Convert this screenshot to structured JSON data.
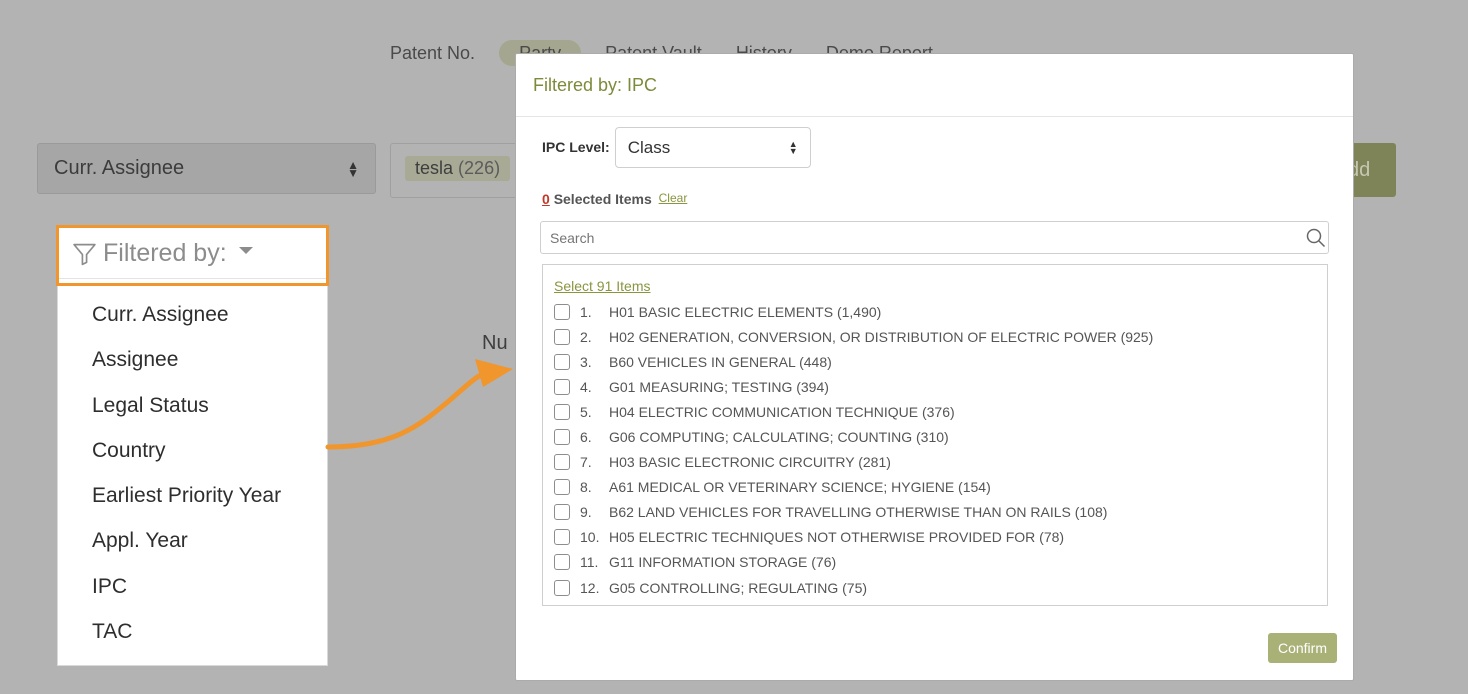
{
  "nav": {
    "tabs": [
      "Patent No.",
      "Party",
      "Patent Vault",
      "History",
      "Demo Report"
    ]
  },
  "search_bar": {
    "field": "Curr. Assignee",
    "tag": "tesla",
    "tag_count": "(226)",
    "add": "dd"
  },
  "background_text": "Nu",
  "filter_panel": {
    "label": "Filtered by:",
    "options": [
      "Curr. Assignee",
      "Assignee",
      "Legal Status",
      "Country",
      "Earliest Priority Year",
      "Appl. Year",
      "IPC",
      "TAC"
    ]
  },
  "modal": {
    "title": "Filtered by: IPC",
    "ipc_level_label": "IPC Level:",
    "ipc_level_value": "Class",
    "selected_count": "0",
    "selected_label": "Selected Items",
    "clear": "Clear",
    "search_placeholder": "Search",
    "select_all": "Select 91 Items",
    "items": [
      {
        "num": "1.",
        "label": "H01 BASIC ELECTRIC ELEMENTS (1,490)"
      },
      {
        "num": "2.",
        "label": "H02 GENERATION, CONVERSION, OR DISTRIBUTION OF ELECTRIC POWER (925)"
      },
      {
        "num": "3.",
        "label": "B60 VEHICLES IN GENERAL (448)"
      },
      {
        "num": "4.",
        "label": "G01 MEASURING; TESTING (394)"
      },
      {
        "num": "5.",
        "label": "H04 ELECTRIC COMMUNICATION TECHNIQUE (376)"
      },
      {
        "num": "6.",
        "label": "G06 COMPUTING; CALCULATING; COUNTING (310)"
      },
      {
        "num": "7.",
        "label": "H03 BASIC ELECTRONIC CIRCUITRY (281)"
      },
      {
        "num": "8.",
        "label": "A61 MEDICAL OR VETERINARY SCIENCE; HYGIENE (154)"
      },
      {
        "num": "9.",
        "label": "B62 LAND VEHICLES FOR TRAVELLING OTHERWISE THAN ON RAILS (108)"
      },
      {
        "num": "10.",
        "label": "H05 ELECTRIC TECHNIQUES NOT OTHERWISE PROVIDED FOR (78)"
      },
      {
        "num": "11.",
        "label": "G11 INFORMATION STORAGE (76)"
      },
      {
        "num": "12.",
        "label": "G05 CONTROLLING; REGULATING (75)"
      }
    ],
    "confirm": "Confirm"
  },
  "colors": {
    "highlight": "#f0962d",
    "accent": "#8a9540",
    "confirm": "#aab177"
  }
}
